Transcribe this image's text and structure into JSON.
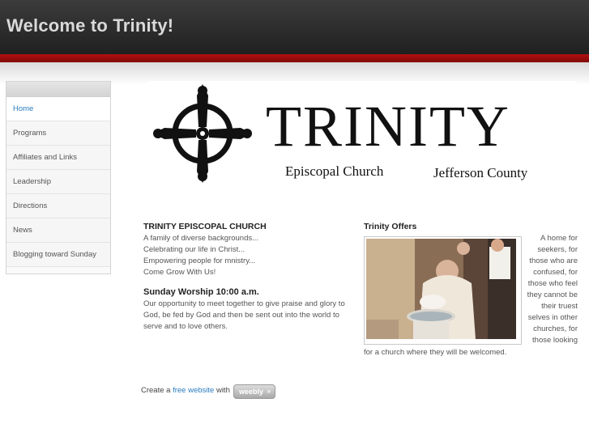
{
  "header": {
    "title": "Welcome to Trinity!"
  },
  "sidebar": {
    "items": [
      {
        "label": "Home",
        "active": true
      },
      {
        "label": "Programs",
        "active": false
      },
      {
        "label": "Affiliates and Links",
        "active": false
      },
      {
        "label": "Leadership",
        "active": false
      },
      {
        "label": "Directions",
        "active": false
      },
      {
        "label": "News",
        "active": false
      },
      {
        "label": "Blogging toward Sunday",
        "active": false
      }
    ]
  },
  "banner": {
    "logo_word": "TRINITY",
    "subtitle_left": "Episcopal Church",
    "subtitle_right": "Jefferson County",
    "icon": "celtic-cross-icon"
  },
  "intro": {
    "heading": "TRINITY EPISCOPAL CHURCH",
    "lines": [
      "A family of diverse backgrounds...",
      "Celebrating our life in Christ...",
      "Empowering people for mnistry...",
      "Come Grow With Us!"
    ],
    "worship_heading": "Sunday Worship 10:00 a.m.",
    "worship_lines": [
      "Our opportunity to meet together to give praise and glory to",
      "God, be fed by God and then be sent out into the world to",
      "serve and to love others."
    ]
  },
  "offers": {
    "title": "Trinity Offers",
    "side_lines": [
      "A home for",
      "seekers, for",
      "those who are",
      "confused, for",
      "those who feel",
      "they cannot be",
      "their truest",
      "selves in other",
      "churches, for",
      "those looking"
    ],
    "bottom_line": "for a church where they will be welcomed."
  },
  "footer": {
    "prefix": "Create a",
    "link": "free website",
    "suffix": "with",
    "badge": "weebly",
    "badge_arrow": "»"
  },
  "colors": {
    "header_bg": "#2a2a2a",
    "accent_red": "#a00c0c",
    "link_blue": "#2a7cc0"
  }
}
